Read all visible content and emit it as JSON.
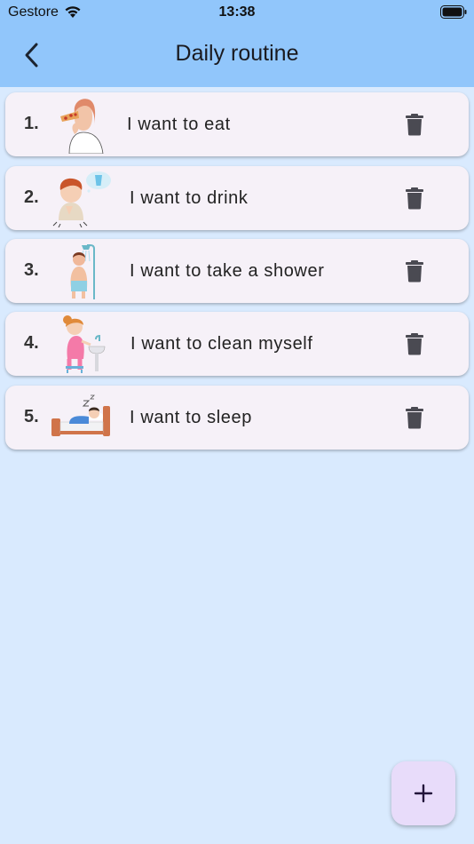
{
  "status_bar": {
    "carrier": "Gestore",
    "time": "13:38"
  },
  "header": {
    "title": "Daily routine"
  },
  "routine": {
    "items": [
      {
        "number": "1.",
        "label": "I want to eat"
      },
      {
        "number": "2.",
        "label": "I want to drink"
      },
      {
        "number": "3.",
        "label": "I want to take a shower"
      },
      {
        "number": "4.",
        "label": "I want to clean myself"
      },
      {
        "number": "5.",
        "label": "I want to sleep"
      }
    ]
  },
  "icons": {
    "back": "chevron-left-icon",
    "delete": "trash-icon",
    "add": "plus-icon"
  },
  "colors": {
    "app_bar": "#91c6fb",
    "background": "#d9eafe",
    "card": "#f6f1f8",
    "fab": "#e8dcfa"
  }
}
